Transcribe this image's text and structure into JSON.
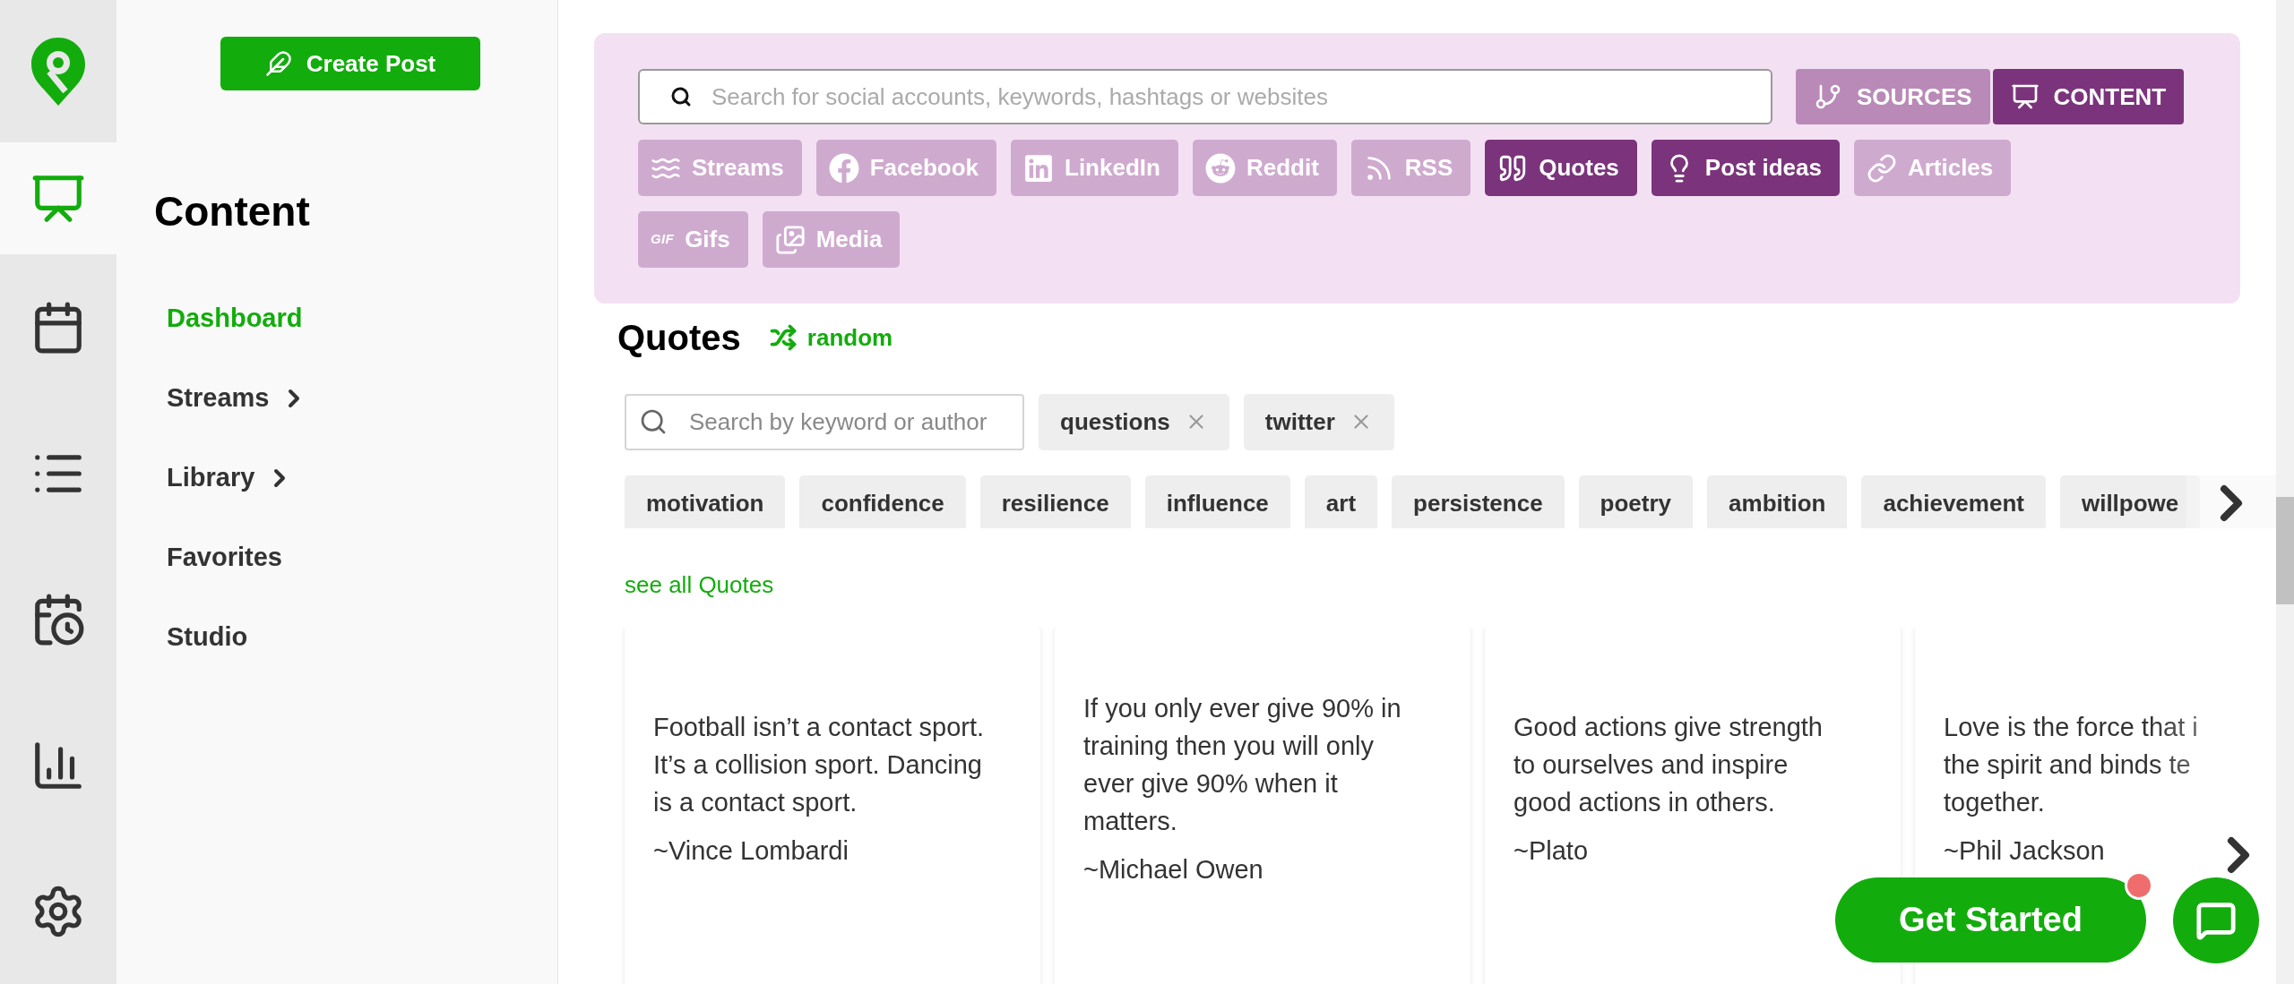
{
  "rail": [
    {
      "kind": "content",
      "selected": true
    },
    {
      "kind": "calendar",
      "selected": false
    },
    {
      "kind": "list",
      "selected": false
    },
    {
      "kind": "schedule",
      "selected": false
    },
    {
      "kind": "analytics",
      "selected": false
    },
    {
      "kind": "settings",
      "selected": false
    }
  ],
  "create_button": "Create Post",
  "sidebar": {
    "title": "Content",
    "items": [
      {
        "label": "Dashboard",
        "selected": true,
        "expandable": false
      },
      {
        "label": "Streams",
        "selected": false,
        "expandable": true
      },
      {
        "label": "Library",
        "selected": false,
        "expandable": true
      },
      {
        "label": "Favorites",
        "selected": false,
        "expandable": false
      },
      {
        "label": "Studio",
        "selected": false,
        "expandable": false
      }
    ]
  },
  "search": {
    "placeholder": "Search for social accounts, keywords, hashtags or websites"
  },
  "modes": [
    {
      "label": "SOURCES",
      "kind": "sources",
      "selected": false
    },
    {
      "label": "CONTENT",
      "kind": "content",
      "selected": true
    }
  ],
  "source_tabs": [
    {
      "label": "Streams",
      "kind": "streams",
      "selected": false
    },
    {
      "label": "Facebook",
      "kind": "facebook",
      "selected": false
    },
    {
      "label": "LinkedIn",
      "kind": "linkedin",
      "selected": false
    },
    {
      "label": "Reddit",
      "kind": "reddit",
      "selected": false
    },
    {
      "label": "RSS",
      "kind": "rss",
      "selected": false
    },
    {
      "label": "Quotes",
      "kind": "quotes",
      "selected": true
    },
    {
      "label": "Post ideas",
      "kind": "ideas",
      "selected": true
    },
    {
      "label": "Articles",
      "kind": "articles",
      "selected": false
    },
    {
      "label": "Gifs",
      "kind": "gifs",
      "icon_text": "GIF",
      "selected": false
    },
    {
      "label": "Media",
      "kind": "media",
      "selected": false
    }
  ],
  "quotes": {
    "title": "Quotes",
    "random": "random",
    "search_placeholder": "Search by keyword or author",
    "active_tags": [
      "questions",
      "twitter"
    ],
    "tags": [
      "motivation",
      "confidence",
      "resilience",
      "influence",
      "art",
      "persistence",
      "poetry",
      "ambition",
      "achievement",
      "willpowe"
    ],
    "see_all": "see all Quotes",
    "cards": [
      {
        "text": "Football isn’t a contact sport. It’s a collision sport. Dancing is a contact sport.",
        "author": "~Vince Lombardi"
      },
      {
        "text": "If you only ever give 90% in training then you will only ever give 90% when it matters.",
        "author": "~Michael Owen"
      },
      {
        "text": "Good actions give strength to ourselves and inspire good actions in others.",
        "author": "~Plato"
      },
      {
        "text": "Love is the force that i\nthe spirit and binds te\ntogether.",
        "author": "~Phil Jackson"
      }
    ]
  },
  "get_started": "Get Started"
}
